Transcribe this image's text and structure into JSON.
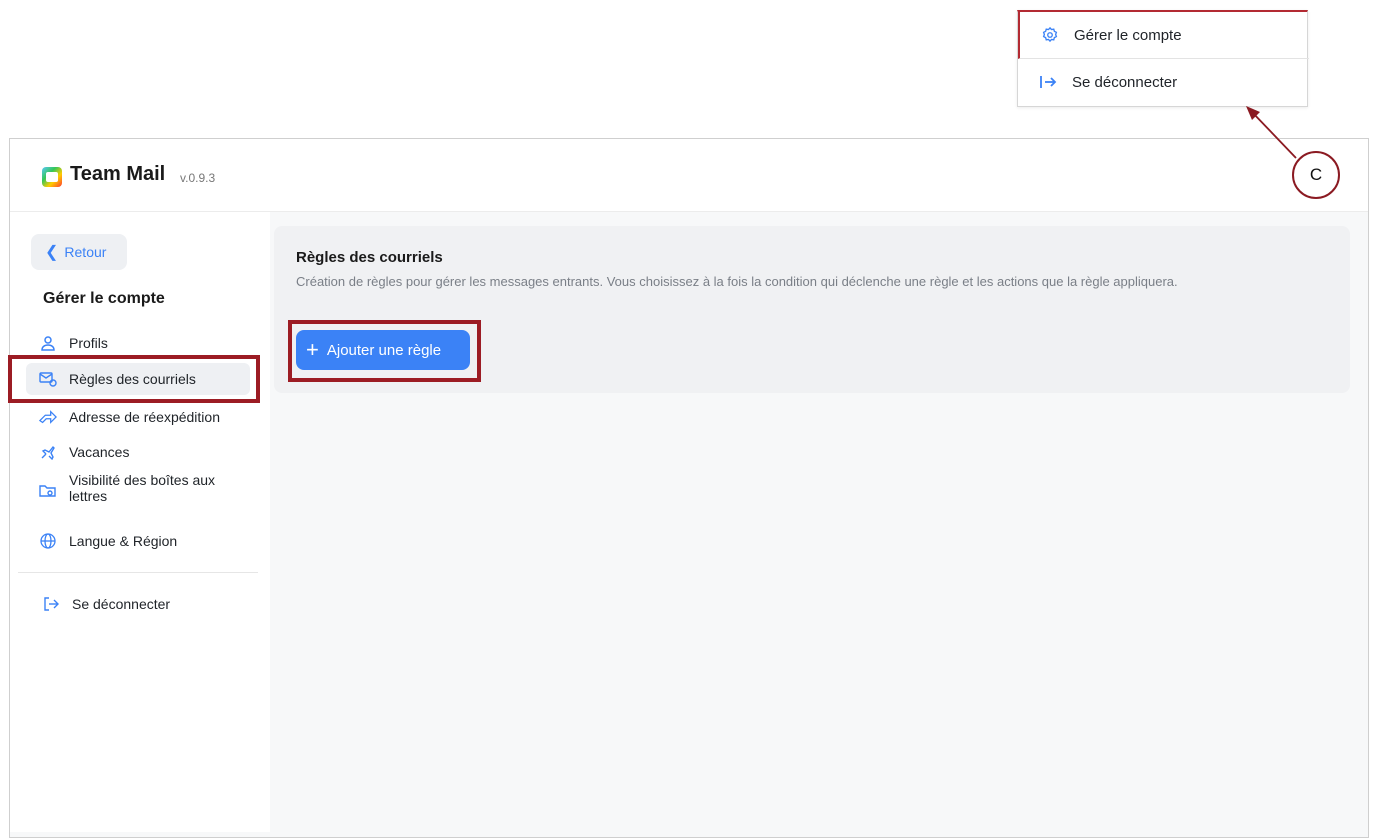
{
  "account_menu": {
    "items": [
      {
        "label": "Gérer le compte",
        "icon": "gear-icon"
      },
      {
        "label": "Se déconnecter",
        "icon": "logout-arrow-icon"
      }
    ]
  },
  "annotation": {
    "label": "C"
  },
  "header": {
    "app_name": "Team Mail",
    "version": "v.0.9.3"
  },
  "sidebar": {
    "back_label": "Retour",
    "heading": "Gérer le compte",
    "items": [
      {
        "label": "Profils",
        "icon": "user-icon"
      },
      {
        "label": "Règles des courriels",
        "icon": "mail-rules-icon",
        "active": true
      },
      {
        "label": "Adresse de réexpédition",
        "icon": "forward-icon"
      },
      {
        "label": "Vacances",
        "icon": "plane-icon"
      },
      {
        "label": "Visibilité des boîtes aux lettres",
        "icon": "mailbox-visibility-icon"
      },
      {
        "label": "Langue & Région",
        "icon": "globe-icon"
      }
    ],
    "logout_label": "Se déconnecter"
  },
  "main": {
    "title": "Règles des courriels",
    "description": "Création de règles pour gérer les messages entrants. Vous choisissez à la fois la condition qui déclenche une règle et les actions que la règle appliquera.",
    "add_button_label": "Ajouter une règle"
  },
  "colors": {
    "accent": "#3b82f6",
    "highlight": "#9c1c24"
  }
}
